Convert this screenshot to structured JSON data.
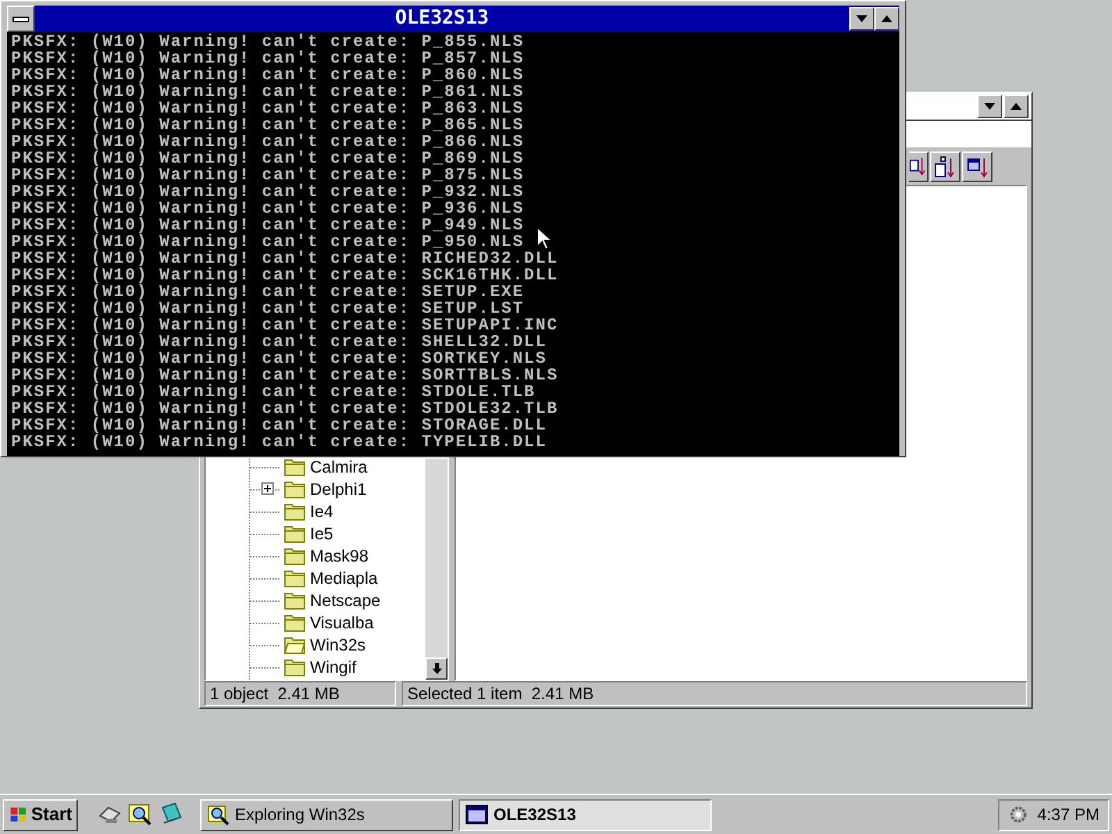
{
  "console": {
    "title": "OLE32S13",
    "lines": [
      "PKSFX: (W10) Warning! can't create: P_855.NLS",
      "PKSFX: (W10) Warning! can't create: P_857.NLS",
      "PKSFX: (W10) Warning! can't create: P_860.NLS",
      "PKSFX: (W10) Warning! can't create: P_861.NLS",
      "PKSFX: (W10) Warning! can't create: P_863.NLS",
      "PKSFX: (W10) Warning! can't create: P_865.NLS",
      "PKSFX: (W10) Warning! can't create: P_866.NLS",
      "PKSFX: (W10) Warning! can't create: P_869.NLS",
      "PKSFX: (W10) Warning! can't create: P_875.NLS",
      "PKSFX: (W10) Warning! can't create: P_932.NLS",
      "PKSFX: (W10) Warning! can't create: P_936.NLS",
      "PKSFX: (W10) Warning! can't create: P_949.NLS",
      "PKSFX: (W10) Warning! can't create: P_950.NLS",
      "PKSFX: (W10) Warning! can't create: RICHED32.DLL",
      "PKSFX: (W10) Warning! can't create: SCK16THK.DLL",
      "PKSFX: (W10) Warning! can't create: SETUP.EXE",
      "PKSFX: (W10) Warning! can't create: SETUP.LST",
      "PKSFX: (W10) Warning! can't create: SETUPAPI.INC",
      "PKSFX: (W10) Warning! can't create: SHELL32.DLL",
      "PKSFX: (W10) Warning! can't create: SORTKEY.NLS",
      "PKSFX: (W10) Warning! can't create: SORTTBLS.NLS",
      "PKSFX: (W10) Warning! can't create: STDOLE.TLB",
      "PKSFX: (W10) Warning! can't create: STDOLE32.TLB",
      "PKSFX: (W10) Warning! can't create: STORAGE.DLL",
      "PKSFX: (W10) Warning! can't create: TYPELIB.DLL"
    ]
  },
  "explorer": {
    "tree": [
      {
        "label": "Calmira",
        "expandable": false,
        "open": false
      },
      {
        "label": "Delphi1",
        "expandable": true,
        "open": false
      },
      {
        "label": "Ie4",
        "expandable": false,
        "open": false
      },
      {
        "label": "Ie5",
        "expandable": false,
        "open": false
      },
      {
        "label": "Mask98",
        "expandable": false,
        "open": false
      },
      {
        "label": "Mediapla",
        "expandable": false,
        "open": false
      },
      {
        "label": "Netscape",
        "expandable": false,
        "open": false
      },
      {
        "label": "Visualba",
        "expandable": false,
        "open": false
      },
      {
        "label": "Win32s",
        "expandable": false,
        "open": true
      },
      {
        "label": "Wingif",
        "expandable": false,
        "open": false
      }
    ],
    "status_bar": [
      "1 object  2.41 MB",
      "Selected 1 item  2.41 MB"
    ]
  },
  "taskbar": {
    "start": "Start",
    "buttons": [
      {
        "label": "Exploring Win32s",
        "selected": false
      },
      {
        "label": "OLE32S13",
        "selected": true
      }
    ],
    "clock": "4:37 PM"
  }
}
